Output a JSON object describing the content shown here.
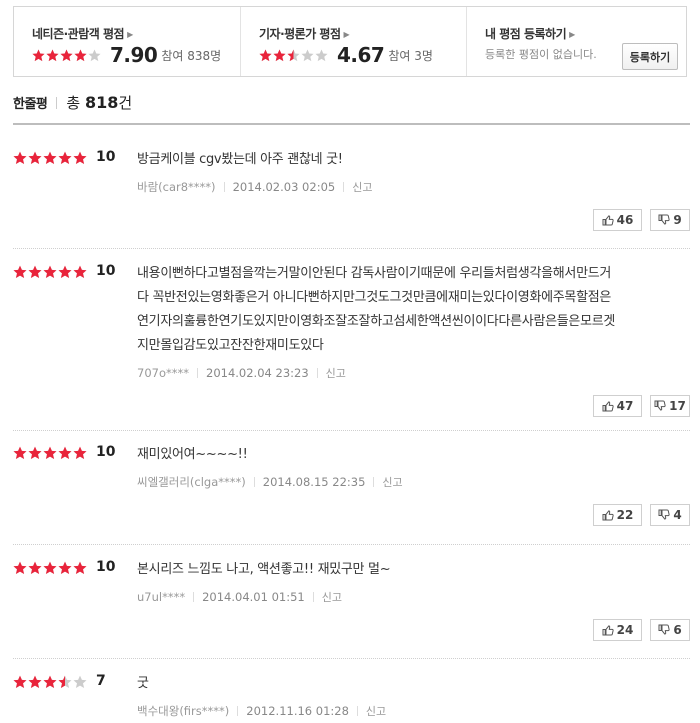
{
  "summary": {
    "netizen": {
      "title": "네티즌·관람객 평점",
      "score": "7.90",
      "participants": "참여 838명",
      "rating": 8
    },
    "critic": {
      "title": "기자·평론가 평점",
      "score": "4.67",
      "participants": "참여 3명",
      "rating": 5
    },
    "mine": {
      "title": "내 평점 등록하기",
      "desc": "등록한 평점이 없습니다.",
      "button": "등록하기"
    }
  },
  "section": {
    "title": "한줄평",
    "total_prefix": "총",
    "total_count": "818",
    "total_suffix": "건"
  },
  "colors": {
    "star_on": "#e9243b",
    "star_off": "#cccccc"
  },
  "reviews": [
    {
      "rating": 10,
      "score": "10",
      "lines": [
        "방금케이블 cgv봤는데 아주 괜찮네 굿!"
      ],
      "author": "바람(car8****)",
      "date": "2014.02.03 02:05",
      "report": "신고",
      "likes": "46",
      "dislikes": "9"
    },
    {
      "rating": 10,
      "score": "10",
      "lines": [
        "내용이뻔하다고별점을깍는거말이안된다 감독사람이기때문에 우리들처럼생각을해서만드거",
        "다 꼭반전있는영화좋은거 아니다뻔하지만그것도그것만큼에재미는있다이영화에주목할점은",
        "연기자의훌륭한연기도있지만이영화조잘조잘하고섬세한액션씬이이다다른사람은들은모르겟",
        "지만몰입감도있고잔잔한재미도있다"
      ],
      "author": "707o****",
      "date": "2014.02.04 23:23",
      "report": "신고",
      "likes": "47",
      "dislikes": "17"
    },
    {
      "rating": 10,
      "score": "10",
      "lines": [
        "재미있어여~~~~!!"
      ],
      "author": "씨엘갤러리(clga****)",
      "date": "2014.08.15 22:35",
      "report": "신고",
      "likes": "22",
      "dislikes": "4"
    },
    {
      "rating": 10,
      "score": "10",
      "lines": [
        "본시리즈 느낌도 나고, 액션좋고!! 재밌구만 멀~"
      ],
      "author": "u7ul****",
      "date": "2014.04.01 01:51",
      "report": "신고",
      "likes": "24",
      "dislikes": "6"
    },
    {
      "rating": 7,
      "score": "7",
      "lines": [
        "굿"
      ],
      "author": "백수대왕(firs****)",
      "date": "2012.11.16 01:28",
      "report": "신고",
      "likes": "",
      "dislikes": ""
    }
  ]
}
